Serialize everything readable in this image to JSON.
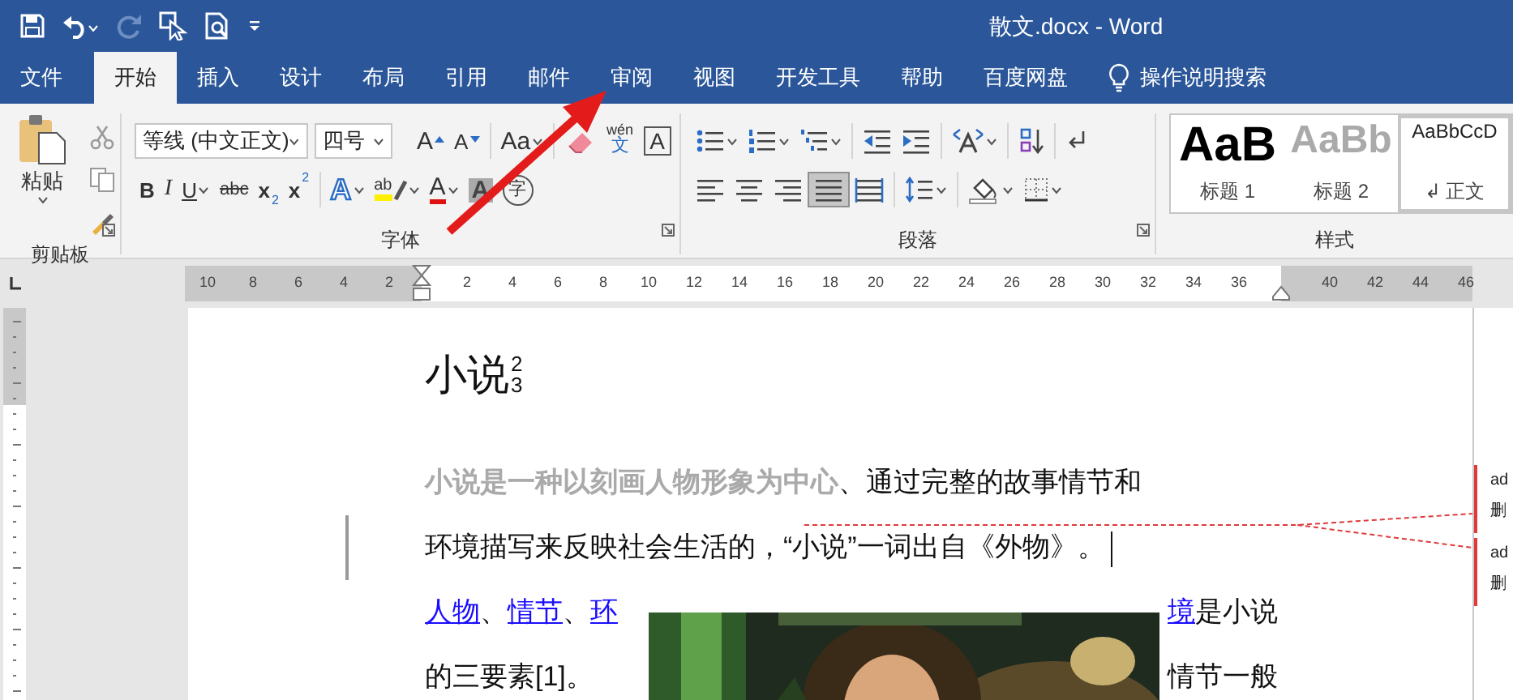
{
  "title_bar": {
    "title": "散文.docx  -  Word",
    "quick_access": [
      {
        "kind": "save",
        "disabled": false
      },
      {
        "kind": "undo",
        "disabled": false
      },
      {
        "kind": "redo",
        "disabled": true
      },
      {
        "kind": "touch",
        "disabled": false
      },
      {
        "kind": "preview",
        "disabled": false
      },
      {
        "kind": "customize",
        "disabled": false
      }
    ]
  },
  "tabs": [
    {
      "label": "文件",
      "selected": false
    },
    {
      "label": "开始",
      "selected": true
    },
    {
      "label": "插入",
      "selected": false
    },
    {
      "label": "设计",
      "selected": false
    },
    {
      "label": "布局",
      "selected": false
    },
    {
      "label": "引用",
      "selected": false
    },
    {
      "label": "邮件",
      "selected": false
    },
    {
      "label": "审阅",
      "selected": false
    },
    {
      "label": "视图",
      "selected": false
    },
    {
      "label": "开发工具",
      "selected": false
    },
    {
      "label": "帮助",
      "selected": false
    },
    {
      "label": "百度网盘",
      "selected": false
    }
  ],
  "tell_me": {
    "label": "操作说明搜索"
  },
  "ribbon": {
    "clipboard": {
      "paste_label": "粘贴",
      "group_label": "剪贴板"
    },
    "font": {
      "font_name": "等线 (中文正文)",
      "font_size": "四号",
      "group_label": "字体",
      "row1": [
        {
          "kind": "grow",
          "text": "A"
        },
        {
          "kind": "shrink",
          "text": "A"
        },
        {
          "kind": "sep"
        },
        {
          "kind": "case",
          "text": "Aa",
          "dropdown": true
        },
        {
          "kind": "sep"
        },
        {
          "kind": "clear"
        },
        {
          "kind": "phonetic",
          "text": "文",
          "ruby": "wén"
        },
        {
          "kind": "border",
          "text": "A"
        }
      ],
      "row2": [
        {
          "kind": "bold",
          "text": "B"
        },
        {
          "kind": "italic",
          "text": "I"
        },
        {
          "kind": "underline",
          "text": "U",
          "dropdown": true
        },
        {
          "kind": "strike",
          "text": "abc"
        },
        {
          "kind": "sub",
          "text": "x",
          "mark": "2"
        },
        {
          "kind": "sup",
          "text": "x",
          "mark": "2"
        },
        {
          "kind": "sep"
        },
        {
          "kind": "effect",
          "text": "A",
          "dropdown": true
        },
        {
          "kind": "highlight",
          "text": "ab",
          "dropdown": true
        },
        {
          "kind": "color",
          "text": "A",
          "dropdown": true
        },
        {
          "kind": "shade",
          "text": "A"
        },
        {
          "kind": "enclose",
          "text": "字"
        }
      ]
    },
    "paragraph": {
      "group_label": "段落",
      "row1": [
        {
          "kind": "bullets",
          "dropdown": true
        },
        {
          "kind": "numbering",
          "dropdown": true
        },
        {
          "kind": "multilevel",
          "dropdown": true
        },
        {
          "kind": "sep"
        },
        {
          "kind": "outdent",
          "dropdown": false
        },
        {
          "kind": "indent",
          "dropdown": false
        },
        {
          "kind": "sep"
        },
        {
          "kind": "asian",
          "dropdown": true
        },
        {
          "kind": "sep"
        },
        {
          "kind": "sort",
          "dropdown": false
        },
        {
          "kind": "sep"
        },
        {
          "kind": "marks",
          "dropdown": false
        }
      ],
      "alignment": [
        {
          "kind": "left",
          "selected": false
        },
        {
          "kind": "center",
          "selected": false
        },
        {
          "kind": "right",
          "selected": false
        },
        {
          "kind": "justify",
          "selected": true
        },
        {
          "kind": "distributed",
          "selected": false
        }
      ],
      "row2": [
        {
          "kind": "sep"
        },
        {
          "kind": "spacing",
          "dropdown": true
        },
        {
          "kind": "sep"
        },
        {
          "kind": "shading",
          "dropdown": true
        },
        {
          "kind": "borders",
          "dropdown": true
        }
      ]
    },
    "styles": {
      "group_label": "样式",
      "items": [
        {
          "kind": "heading1",
          "preview": "AaB",
          "label": "标题 1",
          "selected": false
        },
        {
          "kind": "heading2",
          "preview": "AaBb",
          "label": "标题 2",
          "selected": false
        },
        {
          "kind": "normal",
          "preview": "AaBbCcD",
          "label": "↲ 正文",
          "selected": true
        }
      ]
    }
  },
  "ruler": {
    "left_labels": [
      "10",
      "8",
      "6",
      "4",
      "2"
    ],
    "labels": [
      "2",
      "4",
      "6",
      "8",
      "10",
      "12",
      "14",
      "16",
      "18",
      "20",
      "22",
      "24",
      "26",
      "28",
      "30",
      "32",
      "34",
      "36"
    ],
    "right_labels": [
      "40",
      "42",
      "44",
      "46"
    ]
  },
  "document": {
    "heading": {
      "text": "小说",
      "sup": "2",
      "sub": "3"
    },
    "lines": [
      {
        "changed": false,
        "cursor": false,
        "segments": [
          {
            "kind": "bold",
            "text": "小说是一种以刻画人物形象为中心"
          },
          {
            "kind": "plain",
            "text": "、通过完整的故事情节和"
          }
        ]
      },
      {
        "changed": true,
        "cursor": true,
        "segments": [
          {
            "kind": "plain",
            "text": "环境描写来反映社会生活的，“小说”一词出自《外物》。"
          }
        ]
      }
    ],
    "wrapped_lines": [
      {
        "left": [
          {
            "kind": "link",
            "text": "人物"
          },
          {
            "kind": "plain",
            "text": "、"
          },
          {
            "kind": "link",
            "text": "情节"
          },
          {
            "kind": "plain",
            "text": "、"
          },
          {
            "kind": "link",
            "text": "环"
          }
        ],
        "right": [
          {
            "kind": "link",
            "text": "境"
          },
          {
            "kind": "plain",
            "text": "是小说"
          }
        ]
      },
      {
        "left": [
          {
            "kind": "plain",
            "text": "的三要素[1]。"
          }
        ],
        "right": [
          {
            "kind": "plain",
            "text": "情节一般"
          }
        ]
      }
    ],
    "comments": [
      {
        "lines": [
          "ad",
          "删"
        ]
      },
      {
        "lines": [
          "ad",
          "删"
        ]
      }
    ]
  },
  "annotations": [
    {
      "kind": "arrow"
    }
  ]
}
